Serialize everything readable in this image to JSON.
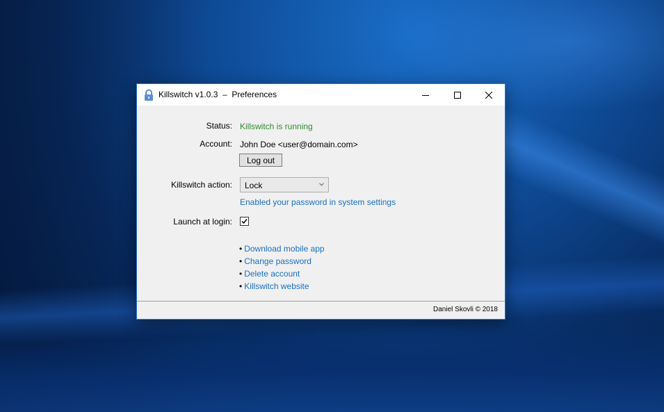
{
  "window": {
    "title": "Killswitch v1.0.3  –  Preferences",
    "accent_border": "#2b7bd6"
  },
  "caption_buttons": {
    "minimize_icon": "minimize-icon",
    "maximize_icon": "maximize-icon",
    "close_icon": "close-icon"
  },
  "status": {
    "label": "Status:",
    "value": "Killswitch is running",
    "color": "#2e8b2e"
  },
  "account": {
    "label": "Account:",
    "value": "John Doe <user@domain.com>",
    "logout_label": "Log out"
  },
  "killswitch_action": {
    "label": "Killswitch action:",
    "selected": "Lock",
    "password_link": "Enabled your password in system settings"
  },
  "launch_at_login": {
    "label": "Launch at login:",
    "checked": true
  },
  "links": [
    {
      "bullet": "•",
      "label": "Download mobile app"
    },
    {
      "bullet": "•",
      "label": "Change password"
    },
    {
      "bullet": "•",
      "label": "Delete account"
    },
    {
      "bullet": "•",
      "label": "Killswitch website"
    }
  ],
  "footer": {
    "text": "Daniel Skovli © 2018"
  },
  "colors": {
    "link": "#1a6fc2",
    "window_bg": "#f0f0f0"
  }
}
